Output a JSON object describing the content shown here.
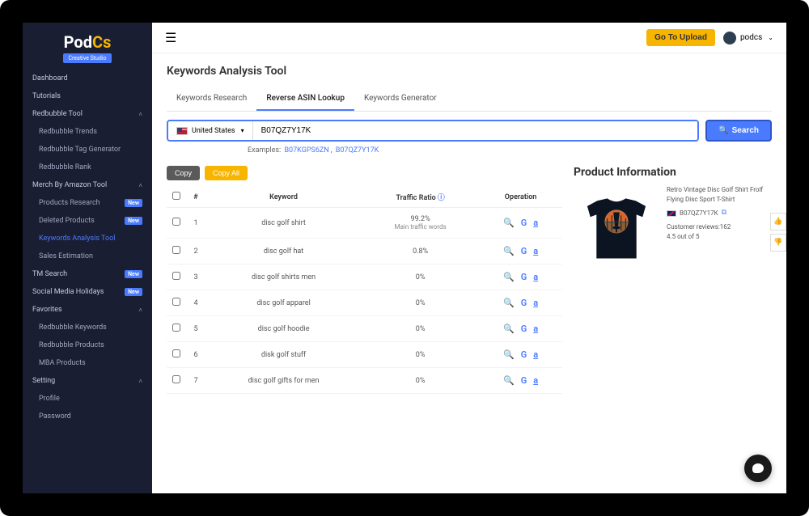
{
  "logo": {
    "text_p": "P",
    "text_od": "od",
    "text_cs": "Cs",
    "badge": "Creative Studio"
  },
  "sidebar": {
    "dashboard": "Dashboard",
    "tutorials": "Tutorials",
    "redbubble_tool": "Redbubble Tool",
    "redbubble_trends": "Redbubble Trends",
    "redbubble_tag": "Redbubble Tag Generator",
    "redbubble_rank": "Redbubble Rank",
    "mba_tool": "Merch By Amazon Tool",
    "products_research": "Products Research",
    "deleted_products": "Deleted Products",
    "keywords_analysis": "Keywords Analysis Tool",
    "sales_estimation": "Sales Estimation",
    "tm_search": "TM Search",
    "social_holidays": "Social Media Holidays",
    "favorites": "Favorites",
    "redbubble_keywords": "Redbubble Keywords",
    "redbubble_products": "Redbubble Products",
    "mba_products": "MBA Products",
    "setting": "Setting",
    "profile": "Profile",
    "password": "Password",
    "new_badge": "New"
  },
  "topbar": {
    "upload": "Go To Upload",
    "username": "podcs"
  },
  "page": {
    "title": "Keywords Analysis Tool"
  },
  "tabs": {
    "research": "Keywords Research",
    "reverse": "Reverse ASIN Lookup",
    "generator": "Keywords Generator"
  },
  "search": {
    "country": "United States",
    "asin": "B07QZ7Y17K",
    "button": "Search",
    "examples_label": "Examples:",
    "example1": "B07KGPS6ZN",
    "example2": "B07QZ7Y17K"
  },
  "buttons": {
    "copy": "Copy",
    "copy_all": "Copy All"
  },
  "table": {
    "col_num": "#",
    "col_keyword": "Keyword",
    "col_traffic": "Traffic Ratio",
    "col_operation": "Operation",
    "rows": [
      {
        "n": "1",
        "keyword": "disc golf shirt",
        "traffic": "99.2%",
        "sub": "Main traffic words"
      },
      {
        "n": "2",
        "keyword": "disc golf hat",
        "traffic": "0.8%",
        "sub": ""
      },
      {
        "n": "3",
        "keyword": "disc golf shirts men",
        "traffic": "0%",
        "sub": ""
      },
      {
        "n": "4",
        "keyword": "disc golf apparel",
        "traffic": "0%",
        "sub": ""
      },
      {
        "n": "5",
        "keyword": "disc golf hoodie",
        "traffic": "0%",
        "sub": ""
      },
      {
        "n": "6",
        "keyword": "disk golf stuff",
        "traffic": "0%",
        "sub": ""
      },
      {
        "n": "7",
        "keyword": "disc golf gifts for men",
        "traffic": "0%",
        "sub": ""
      }
    ]
  },
  "product": {
    "heading": "Product Information",
    "name": "Retro Vintage Disc Golf Shirt Frolf Flying Disc Sport T-Shirt",
    "asin": "B07QZ7Y17K",
    "reviews": "Customer reviews:162",
    "rating": "4.5 out of 5"
  },
  "op_icons": {
    "search": "🔍",
    "google": "G",
    "amazon": "a"
  }
}
